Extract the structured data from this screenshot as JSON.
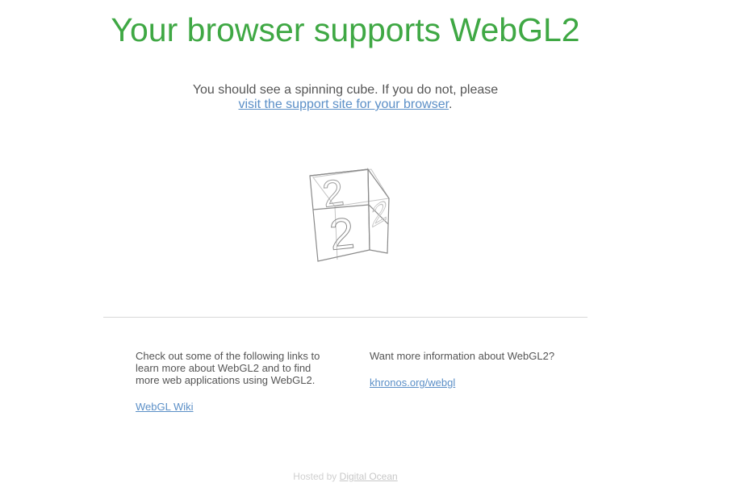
{
  "header": {
    "title": "Your browser supports WebGL2"
  },
  "intro": {
    "text": "You should see a spinning cube. If you do not, please",
    "link_text": "visit the support site for your browser",
    "trailing": "."
  },
  "cube": {
    "glyph": "2"
  },
  "left_column": {
    "text": "Check out some of the following links to learn more about WebGL2 and to find more web applications using WebGL2.",
    "link_text": "WebGL Wiki"
  },
  "right_column": {
    "text": "Want more information about WebGL2?",
    "link_text": "khronos.org/webgl"
  },
  "footer": {
    "prefix": "Hosted by",
    "link_text": "Digital Ocean"
  },
  "colors": {
    "headline": "#3fa844",
    "link": "#5b8fc7",
    "body_text": "#555555"
  }
}
